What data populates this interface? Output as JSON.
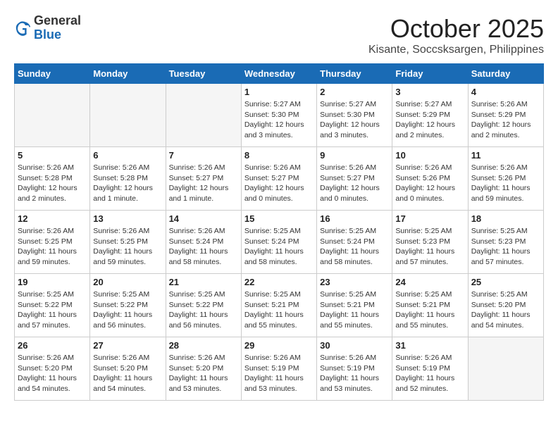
{
  "header": {
    "logo_general": "General",
    "logo_blue": "Blue",
    "month": "October 2025",
    "location": "Kisante, Soccsksargen, Philippines"
  },
  "weekdays": [
    "Sunday",
    "Monday",
    "Tuesday",
    "Wednesday",
    "Thursday",
    "Friday",
    "Saturday"
  ],
  "weeks": [
    [
      {
        "day": "",
        "info": ""
      },
      {
        "day": "",
        "info": ""
      },
      {
        "day": "",
        "info": ""
      },
      {
        "day": "1",
        "info": "Sunrise: 5:27 AM\nSunset: 5:30 PM\nDaylight: 12 hours\nand 3 minutes."
      },
      {
        "day": "2",
        "info": "Sunrise: 5:27 AM\nSunset: 5:30 PM\nDaylight: 12 hours\nand 3 minutes."
      },
      {
        "day": "3",
        "info": "Sunrise: 5:27 AM\nSunset: 5:29 PM\nDaylight: 12 hours\nand 2 minutes."
      },
      {
        "day": "4",
        "info": "Sunrise: 5:26 AM\nSunset: 5:29 PM\nDaylight: 12 hours\nand 2 minutes."
      }
    ],
    [
      {
        "day": "5",
        "info": "Sunrise: 5:26 AM\nSunset: 5:28 PM\nDaylight: 12 hours\nand 2 minutes."
      },
      {
        "day": "6",
        "info": "Sunrise: 5:26 AM\nSunset: 5:28 PM\nDaylight: 12 hours\nand 1 minute."
      },
      {
        "day": "7",
        "info": "Sunrise: 5:26 AM\nSunset: 5:27 PM\nDaylight: 12 hours\nand 1 minute."
      },
      {
        "day": "8",
        "info": "Sunrise: 5:26 AM\nSunset: 5:27 PM\nDaylight: 12 hours\nand 0 minutes."
      },
      {
        "day": "9",
        "info": "Sunrise: 5:26 AM\nSunset: 5:27 PM\nDaylight: 12 hours\nand 0 minutes."
      },
      {
        "day": "10",
        "info": "Sunrise: 5:26 AM\nSunset: 5:26 PM\nDaylight: 12 hours\nand 0 minutes."
      },
      {
        "day": "11",
        "info": "Sunrise: 5:26 AM\nSunset: 5:26 PM\nDaylight: 11 hours\nand 59 minutes."
      }
    ],
    [
      {
        "day": "12",
        "info": "Sunrise: 5:26 AM\nSunset: 5:25 PM\nDaylight: 11 hours\nand 59 minutes."
      },
      {
        "day": "13",
        "info": "Sunrise: 5:26 AM\nSunset: 5:25 PM\nDaylight: 11 hours\nand 59 minutes."
      },
      {
        "day": "14",
        "info": "Sunrise: 5:26 AM\nSunset: 5:24 PM\nDaylight: 11 hours\nand 58 minutes."
      },
      {
        "day": "15",
        "info": "Sunrise: 5:25 AM\nSunset: 5:24 PM\nDaylight: 11 hours\nand 58 minutes."
      },
      {
        "day": "16",
        "info": "Sunrise: 5:25 AM\nSunset: 5:24 PM\nDaylight: 11 hours\nand 58 minutes."
      },
      {
        "day": "17",
        "info": "Sunrise: 5:25 AM\nSunset: 5:23 PM\nDaylight: 11 hours\nand 57 minutes."
      },
      {
        "day": "18",
        "info": "Sunrise: 5:25 AM\nSunset: 5:23 PM\nDaylight: 11 hours\nand 57 minutes."
      }
    ],
    [
      {
        "day": "19",
        "info": "Sunrise: 5:25 AM\nSunset: 5:22 PM\nDaylight: 11 hours\nand 57 minutes."
      },
      {
        "day": "20",
        "info": "Sunrise: 5:25 AM\nSunset: 5:22 PM\nDaylight: 11 hours\nand 56 minutes."
      },
      {
        "day": "21",
        "info": "Sunrise: 5:25 AM\nSunset: 5:22 PM\nDaylight: 11 hours\nand 56 minutes."
      },
      {
        "day": "22",
        "info": "Sunrise: 5:25 AM\nSunset: 5:21 PM\nDaylight: 11 hours\nand 55 minutes."
      },
      {
        "day": "23",
        "info": "Sunrise: 5:25 AM\nSunset: 5:21 PM\nDaylight: 11 hours\nand 55 minutes."
      },
      {
        "day": "24",
        "info": "Sunrise: 5:25 AM\nSunset: 5:21 PM\nDaylight: 11 hours\nand 55 minutes."
      },
      {
        "day": "25",
        "info": "Sunrise: 5:25 AM\nSunset: 5:20 PM\nDaylight: 11 hours\nand 54 minutes."
      }
    ],
    [
      {
        "day": "26",
        "info": "Sunrise: 5:26 AM\nSunset: 5:20 PM\nDaylight: 11 hours\nand 54 minutes."
      },
      {
        "day": "27",
        "info": "Sunrise: 5:26 AM\nSunset: 5:20 PM\nDaylight: 11 hours\nand 54 minutes."
      },
      {
        "day": "28",
        "info": "Sunrise: 5:26 AM\nSunset: 5:20 PM\nDaylight: 11 hours\nand 53 minutes."
      },
      {
        "day": "29",
        "info": "Sunrise: 5:26 AM\nSunset: 5:19 PM\nDaylight: 11 hours\nand 53 minutes."
      },
      {
        "day": "30",
        "info": "Sunrise: 5:26 AM\nSunset: 5:19 PM\nDaylight: 11 hours\nand 53 minutes."
      },
      {
        "day": "31",
        "info": "Sunrise: 5:26 AM\nSunset: 5:19 PM\nDaylight: 11 hours\nand 52 minutes."
      },
      {
        "day": "",
        "info": ""
      }
    ]
  ]
}
